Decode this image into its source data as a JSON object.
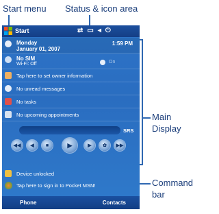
{
  "callouts": {
    "start_menu": "Start menu",
    "status_area": "Status & icon area",
    "main_display_1": "Main",
    "main_display_2": "Display",
    "command_bar_1": "Command",
    "command_bar_2": "bar"
  },
  "device": {
    "start_label": "Start",
    "status_icons": [
      "signal-icon",
      "sync-icon",
      "speaker-icon",
      "power-icon"
    ],
    "date_line1": "Monday",
    "date_line2": "January 01, 2007",
    "time": "1:59 PM",
    "sim_line1": "No SIM",
    "sim_line2": "Wi-Fi: Off",
    "sim_toggle": "On",
    "owner_info": "Tap here to set owner information",
    "messages": "No unread messages",
    "tasks": "No tasks",
    "appointments": "No upcoming appointments",
    "player_label": "SRS",
    "device_status": "Device unlocked",
    "msn": "Tap here to sign in to Pocket MSN!",
    "softkey_left": "Phone",
    "softkey_right": "Contacts"
  },
  "colors": {
    "screen_bg": "#2d74c8",
    "bar_bg": "#143f86",
    "callout_text": "#1a3d7a",
    "leader": "#2e67b1"
  }
}
